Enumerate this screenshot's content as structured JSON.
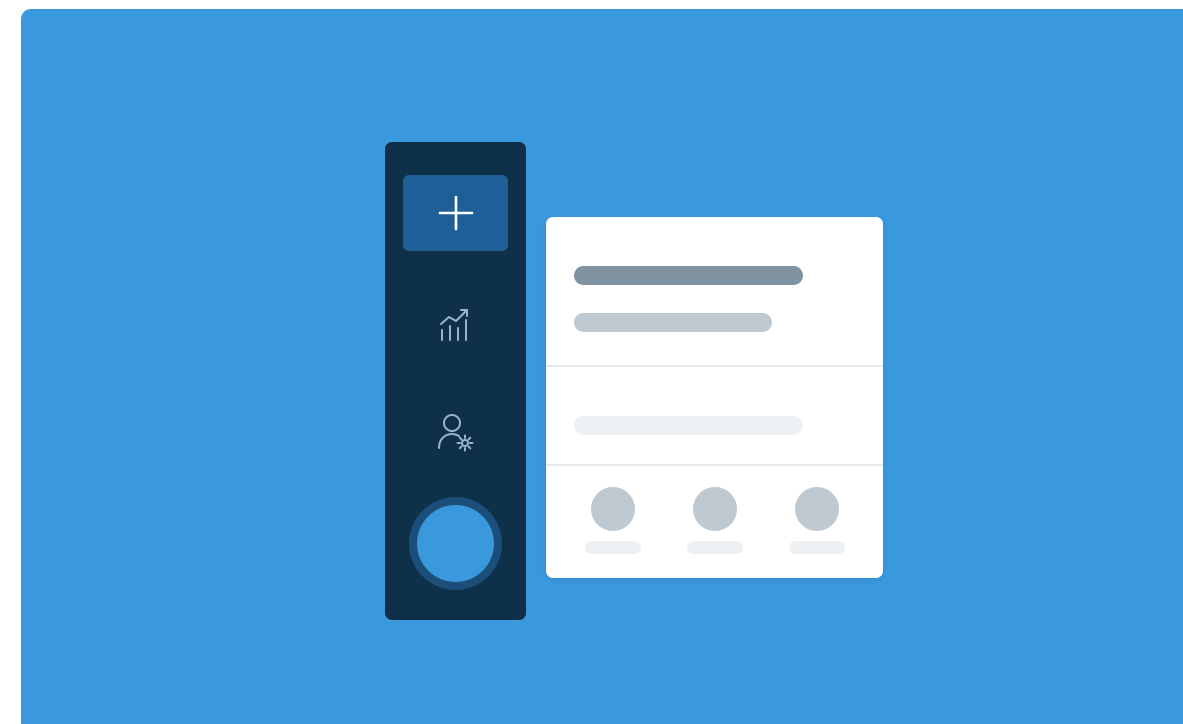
{
  "colors": {
    "background": "#3A98DD",
    "sidebar": "#0F3049",
    "nav_active": "#1D5F96",
    "nav_icon": "#9BB4C7",
    "nav_icon_active": "#FFFFFF",
    "avatar_ring": "#1B4E79",
    "avatar": "#3A98DD",
    "card": "#FFFFFF",
    "placeholder_dark": "#7F93A3",
    "placeholder_mid": "#BFC9D2",
    "placeholder_light": "#EEF1F4",
    "divider": "#E6EAEE"
  },
  "sidebar": {
    "items": [
      {
        "icon": "plus-icon",
        "active": true
      },
      {
        "icon": "analytics-chart-icon",
        "active": false
      },
      {
        "icon": "user-settings-icon",
        "active": false
      }
    ],
    "avatar": {
      "icon": "avatar"
    }
  },
  "card": {
    "contacts_count": 3
  }
}
